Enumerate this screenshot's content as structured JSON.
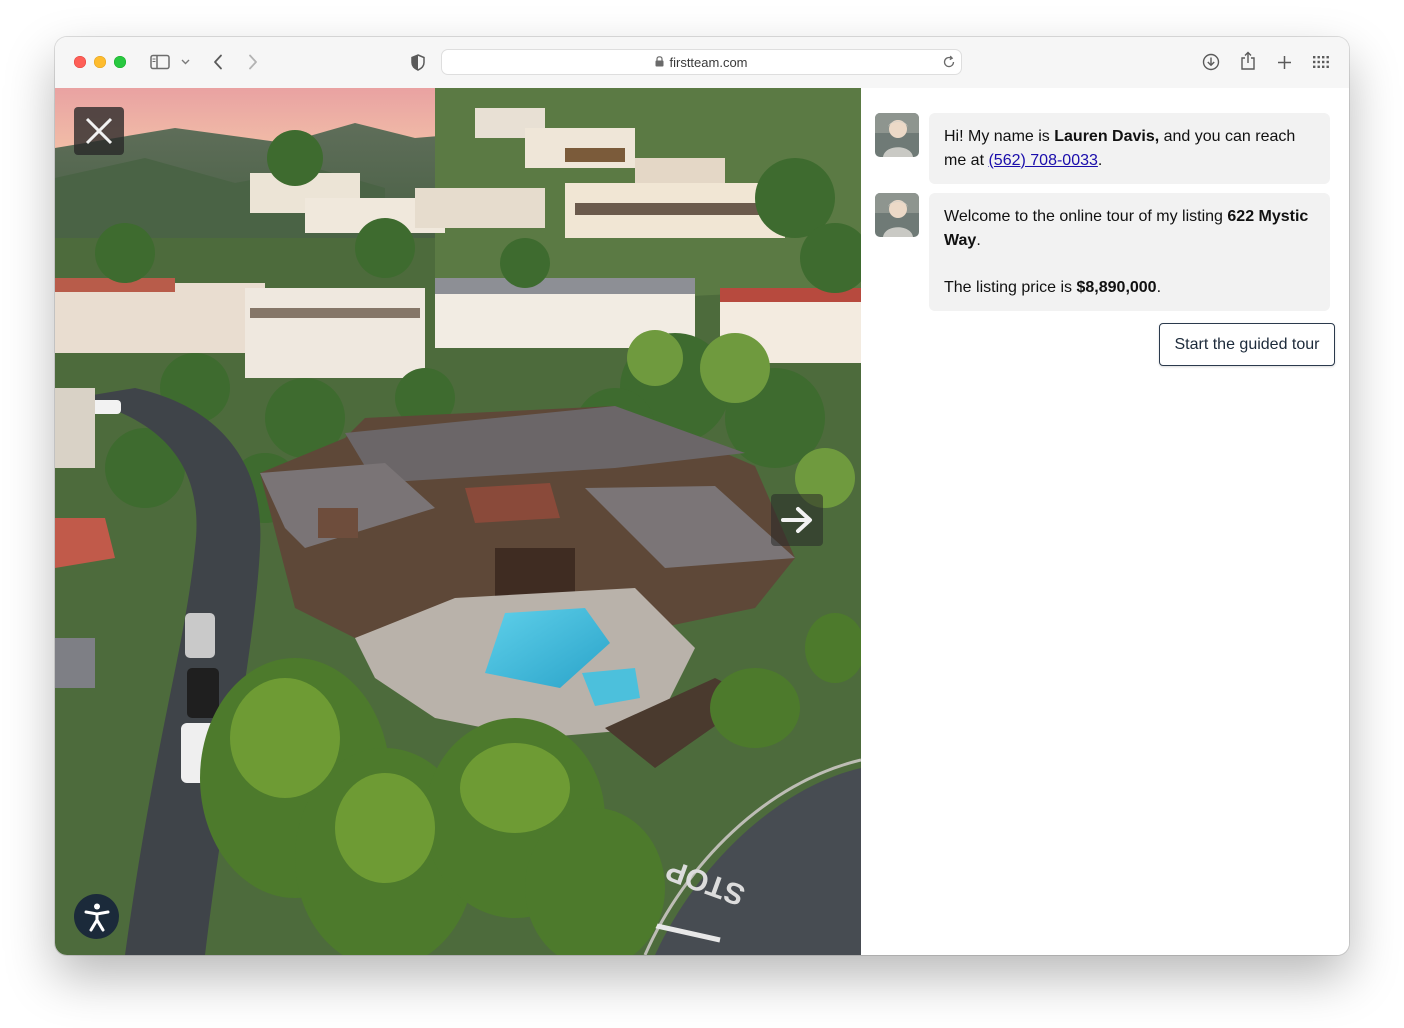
{
  "browser": {
    "url": "firstteam.com"
  },
  "agent": {
    "intro_prefix": "Hi! My name is ",
    "name": "Lauren Davis,",
    "intro_mid": " and you can reach me at ",
    "phone": "(562) 708-0033",
    "intro_suffix": "."
  },
  "listing": {
    "welcome_prefix": "Welcome to the online tour of my listing ",
    "address": "622 Mystic Way",
    "welcome_suffix": ".",
    "price_prefix": "The listing price is ",
    "price": "$8,890,000",
    "price_suffix": "."
  },
  "actions": {
    "guided_tour_label": "Start the guided tour"
  },
  "photo": {
    "road_marking": "STOP"
  },
  "icons": {
    "close": "close-icon",
    "next": "arrow-right-icon",
    "accessibility": "accessibility-icon"
  },
  "colors": {
    "link": "#1a0dab",
    "bubble_bg": "#f2f2f2",
    "button_border": "#2b3a4d",
    "accessibility_bg": "#1b2a3a"
  }
}
